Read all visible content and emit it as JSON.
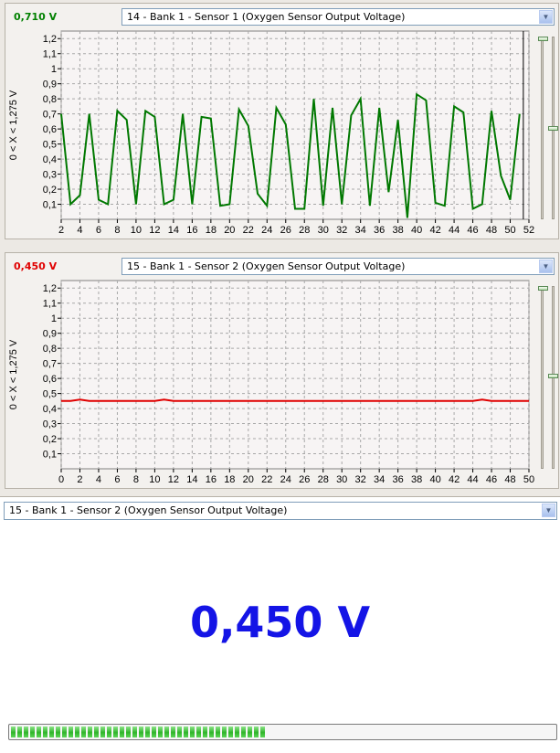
{
  "panel1": {
    "readout": "0,710 V",
    "readout_color": "#008000",
    "sensor": "14 - Bank 1 - Sensor 1 (Oxygen Sensor Output Voltage)",
    "axis_label": "0  < X <  1,275  V"
  },
  "panel2": {
    "readout": "0,450 V",
    "readout_color": "#e00000",
    "sensor": "15 - Bank 1 - Sensor 2 (Oxygen Sensor Output Voltage)",
    "axis_label": "0  < X <  1,275  V"
  },
  "gauge": {
    "sensor": "15 - Bank 1 - Sensor 2 (Oxygen Sensor Output Voltage)",
    "value": "0,450 V",
    "value_color": "#1414e6",
    "progress_fraction": 0.47
  },
  "chart_data": [
    {
      "type": "line",
      "ylabel": "0  < X <  1,275  V",
      "ylim": [
        0,
        1.25
      ],
      "xlim": [
        2,
        52
      ],
      "yticks": [
        "0,1",
        "0,2",
        "0,3",
        "0,4",
        "0,5",
        "0,6",
        "0,7",
        "0,8",
        "0,9",
        "1",
        "1,1",
        "1,2"
      ],
      "xticks": [
        "2",
        "4",
        "6",
        "8",
        "10",
        "12",
        "14",
        "16",
        "18",
        "20",
        "22",
        "24",
        "26",
        "28",
        "30",
        "32",
        "34",
        "36",
        "38",
        "40",
        "42",
        "44",
        "46",
        "48",
        "50",
        "52"
      ],
      "grid": true,
      "series": [
        {
          "color": "#007800",
          "x": [
            2,
            3,
            4,
            5,
            6,
            7,
            8,
            9,
            10,
            11,
            12,
            13,
            14,
            15,
            16,
            17,
            18,
            19,
            20,
            21,
            22,
            23,
            24,
            25,
            26,
            27,
            28,
            29,
            30,
            31,
            32,
            33,
            34,
            35,
            36,
            37,
            38,
            39,
            40,
            41,
            42,
            43,
            44,
            45,
            46,
            47,
            48,
            49,
            50,
            51
          ],
          "y": [
            0.7,
            0.1,
            0.16,
            0.7,
            0.13,
            0.1,
            0.72,
            0.66,
            0.1,
            0.72,
            0.68,
            0.1,
            0.13,
            0.7,
            0.1,
            0.68,
            0.67,
            0.09,
            0.1,
            0.73,
            0.62,
            0.17,
            0.09,
            0.74,
            0.63,
            0.07,
            0.07,
            0.8,
            0.09,
            0.74,
            0.1,
            0.69,
            0.8,
            0.09,
            0.74,
            0.18,
            0.66,
            0.01,
            0.83,
            0.79,
            0.11,
            0.09,
            0.75,
            0.71,
            0.07,
            0.1,
            0.72,
            0.29,
            0.13,
            0.7
          ]
        }
      ]
    },
    {
      "type": "line",
      "ylabel": "0  < X <  1,275  V",
      "ylim": [
        0,
        1.25
      ],
      "xlim": [
        0,
        50
      ],
      "yticks": [
        "0,1",
        "0,2",
        "0,3",
        "0,4",
        "0,5",
        "0,6",
        "0,7",
        "0,8",
        "0,9",
        "1",
        "1,1",
        "1,2"
      ],
      "xticks": [
        "0",
        "2",
        "4",
        "6",
        "8",
        "10",
        "12",
        "14",
        "16",
        "18",
        "20",
        "22",
        "24",
        "26",
        "28",
        "30",
        "32",
        "34",
        "36",
        "38",
        "40",
        "42",
        "44",
        "46",
        "48",
        "50"
      ],
      "grid": true,
      "series": [
        {
          "color": "#e00000",
          "x": [
            0,
            1,
            2,
            3,
            4,
            5,
            6,
            7,
            8,
            9,
            10,
            11,
            12,
            13,
            14,
            15,
            16,
            17,
            18,
            19,
            20,
            21,
            22,
            23,
            24,
            25,
            26,
            27,
            28,
            29,
            30,
            31,
            32,
            33,
            34,
            35,
            36,
            37,
            38,
            39,
            40,
            41,
            42,
            43,
            44,
            45,
            46,
            47,
            48,
            49,
            50
          ],
          "y": [
            0.45,
            0.45,
            0.46,
            0.45,
            0.45,
            0.45,
            0.45,
            0.45,
            0.45,
            0.45,
            0.45,
            0.46,
            0.45,
            0.45,
            0.45,
            0.45,
            0.45,
            0.45,
            0.45,
            0.45,
            0.45,
            0.45,
            0.45,
            0.45,
            0.45,
            0.45,
            0.45,
            0.45,
            0.45,
            0.45,
            0.45,
            0.45,
            0.45,
            0.45,
            0.45,
            0.45,
            0.45,
            0.45,
            0.45,
            0.45,
            0.45,
            0.45,
            0.45,
            0.45,
            0.45,
            0.46,
            0.45,
            0.45,
            0.45,
            0.45,
            0.45
          ]
        }
      ]
    }
  ]
}
